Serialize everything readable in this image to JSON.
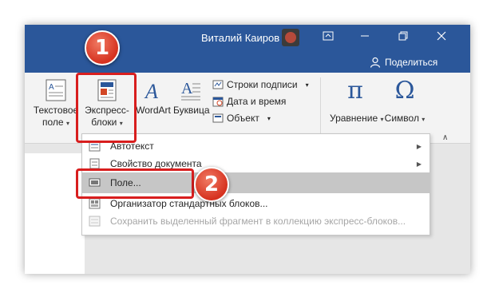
{
  "titlebar": {
    "user_name": "Виталий Каиров",
    "share_label": "Поделиться"
  },
  "ribbon": {
    "textbox": {
      "line1": "Текстовое",
      "line2": "поле"
    },
    "quickparts": {
      "line1": "Экспресс-",
      "line2": "блоки"
    },
    "wordart": {
      "label": "WordArt"
    },
    "dropcap": {
      "label": "Буквица"
    },
    "signature_line": "Строки подписи",
    "date_time": "Дата и время",
    "object": "Объект",
    "equation": "Уравнение",
    "symbol": "Символ"
  },
  "menu": {
    "items": [
      {
        "label": "Автотекст",
        "submenu": true
      },
      {
        "label": "Свойство документа",
        "submenu": true
      },
      {
        "label": "Поле..."
      },
      {
        "label": "Организатор стандартных блоков..."
      },
      {
        "label": "Сохранить выделенный фрагмент в коллекцию экспресс-блоков..."
      }
    ]
  },
  "callouts": {
    "step1": "1",
    "step2": "2"
  },
  "colors": {
    "titlebar": "#2b579a",
    "highlight": "#d81e1e",
    "selected_item": "#c6c6c6"
  }
}
